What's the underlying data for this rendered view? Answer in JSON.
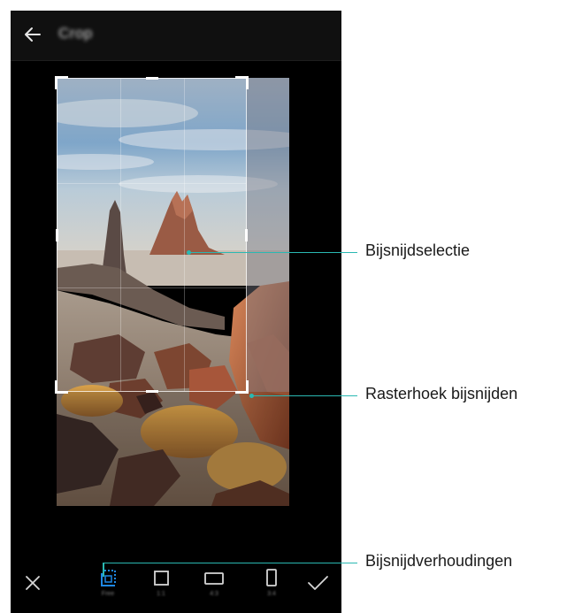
{
  "screen": {
    "title": "Crop"
  },
  "toolbar": {
    "tools": [
      {
        "id": "cancel",
        "icon": "close-icon"
      },
      {
        "id": "crop-ratio-free",
        "icon": "crop-free-icon",
        "label": "Free",
        "selected": true,
        "accent": "#1e88e5"
      },
      {
        "id": "crop-ratio-1-1",
        "icon": "square-ratio-icon",
        "label": "1:1"
      },
      {
        "id": "crop-ratio-4-3",
        "icon": "landscape-ratio-icon",
        "label": "4:3"
      },
      {
        "id": "crop-ratio-3-4",
        "icon": "portrait-ratio-icon",
        "label": "3:4"
      },
      {
        "id": "confirm",
        "icon": "check-icon"
      }
    ]
  },
  "annotations": {
    "crop_selection": "Bijsnijdselectie",
    "grid_corner": "Rasterhoek bijsnijden",
    "aspect_ratios": "Bijsnijdverhoudingen"
  },
  "colors": {
    "callout": "#2ab8b2",
    "accent": "#1e88e5",
    "background": "#000000"
  }
}
